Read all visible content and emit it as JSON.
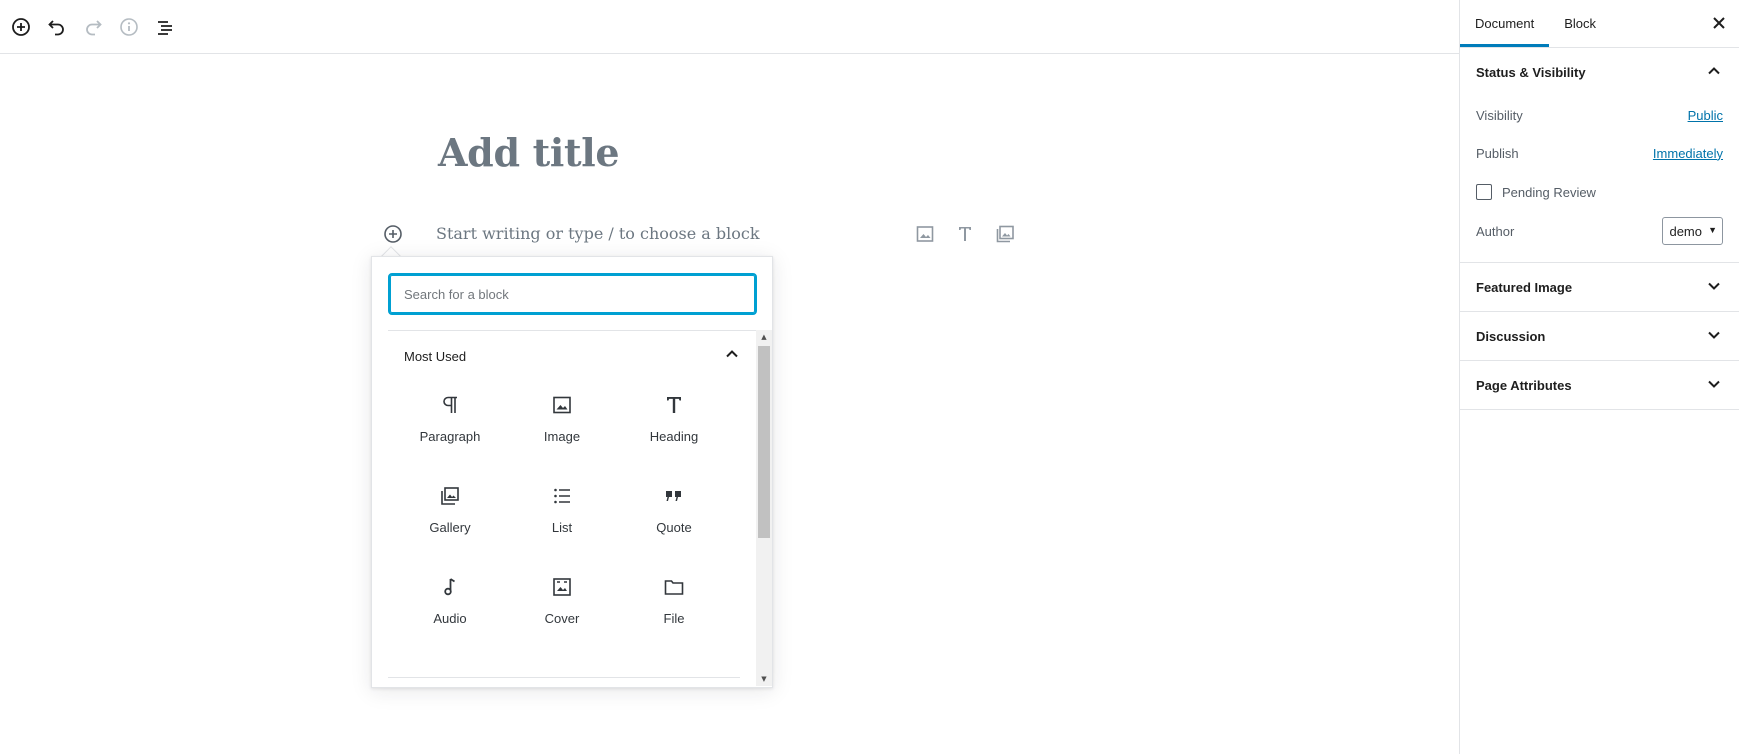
{
  "toolbar": {
    "buttons": [
      "add-block",
      "undo",
      "redo",
      "info",
      "outline"
    ]
  },
  "editor": {
    "title_placeholder": "Add title",
    "body_placeholder": "Start writing or type / to choose a block"
  },
  "inserter": {
    "search_placeholder": "Search for a block",
    "section_title": "Most Used",
    "blocks": [
      {
        "label": "Paragraph",
        "icon": "paragraph-icon"
      },
      {
        "label": "Image",
        "icon": "image-icon"
      },
      {
        "label": "Heading",
        "icon": "heading-icon"
      },
      {
        "label": "Gallery",
        "icon": "gallery-icon"
      },
      {
        "label": "List",
        "icon": "list-icon"
      },
      {
        "label": "Quote",
        "icon": "quote-icon"
      },
      {
        "label": "Audio",
        "icon": "audio-icon"
      },
      {
        "label": "Cover",
        "icon": "cover-icon"
      },
      {
        "label": "File",
        "icon": "file-icon"
      }
    ]
  },
  "sidebar": {
    "tabs": [
      {
        "label": "Document",
        "active": true
      },
      {
        "label": "Block",
        "active": false
      }
    ],
    "status": {
      "title": "Status & Visibility",
      "visibility_label": "Visibility",
      "visibility_value": "Public",
      "publish_label": "Publish",
      "publish_value": "Immediately",
      "pending_label": "Pending Review",
      "author_label": "Author",
      "author_value": "demo"
    },
    "panels": [
      {
        "title": "Featured Image"
      },
      {
        "title": "Discussion"
      },
      {
        "title": "Page Attributes"
      }
    ]
  },
  "colors": {
    "accent": "#007cba",
    "focus": "#00a0d2",
    "link": "#0073aa"
  }
}
